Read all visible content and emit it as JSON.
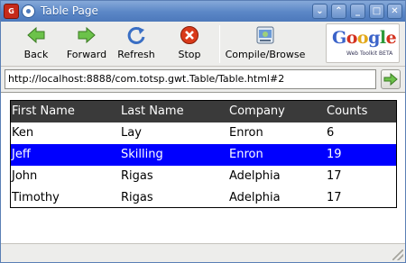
{
  "window": {
    "title": "Table Page",
    "app_icon_text": "G",
    "buttons": [
      {
        "name": "collapse",
        "glyph": "⌄"
      },
      {
        "name": "expand",
        "glyph": "⌃"
      },
      {
        "name": "minimize",
        "glyph": "_"
      },
      {
        "name": "maximize",
        "glyph": "□"
      },
      {
        "name": "close",
        "glyph": "✕"
      }
    ]
  },
  "toolbar": {
    "back_label": "Back",
    "forward_label": "Forward",
    "refresh_label": "Refresh",
    "stop_label": "Stop",
    "compile_label": "Compile/Browse",
    "logo_word": "Google",
    "logo_sub": "Web Toolkit BETA"
  },
  "address": {
    "url": "http://localhost:8888/com.totsp.gwt.Table/Table.html#2"
  },
  "table": {
    "columns": [
      "First Name",
      "Last Name",
      "Company",
      "Counts"
    ],
    "rows": [
      [
        "Ken",
        "Lay",
        "Enron",
        "6"
      ],
      [
        "Jeff",
        "Skilling",
        "Enron",
        "19"
      ],
      [
        "John",
        "Rigas",
        "Adelphia",
        "17"
      ],
      [
        "Timothy",
        "Rigas",
        "Adelphia",
        "17"
      ]
    ],
    "selected_row_index": 1
  },
  "colors": {
    "titlebar": "#5a86c6",
    "table_header": "#3a3a3a",
    "selection": "#0000ff",
    "arrow_green": "#5fb43a",
    "stop_red": "#d93a1a",
    "refresh_blue": "#3a6fc4"
  },
  "icons": {
    "back": "back-arrow-icon",
    "forward": "forward-arrow-icon",
    "refresh": "refresh-icon",
    "stop": "stop-icon",
    "compile": "compile-browse-icon",
    "go": "go-arrow-icon"
  }
}
